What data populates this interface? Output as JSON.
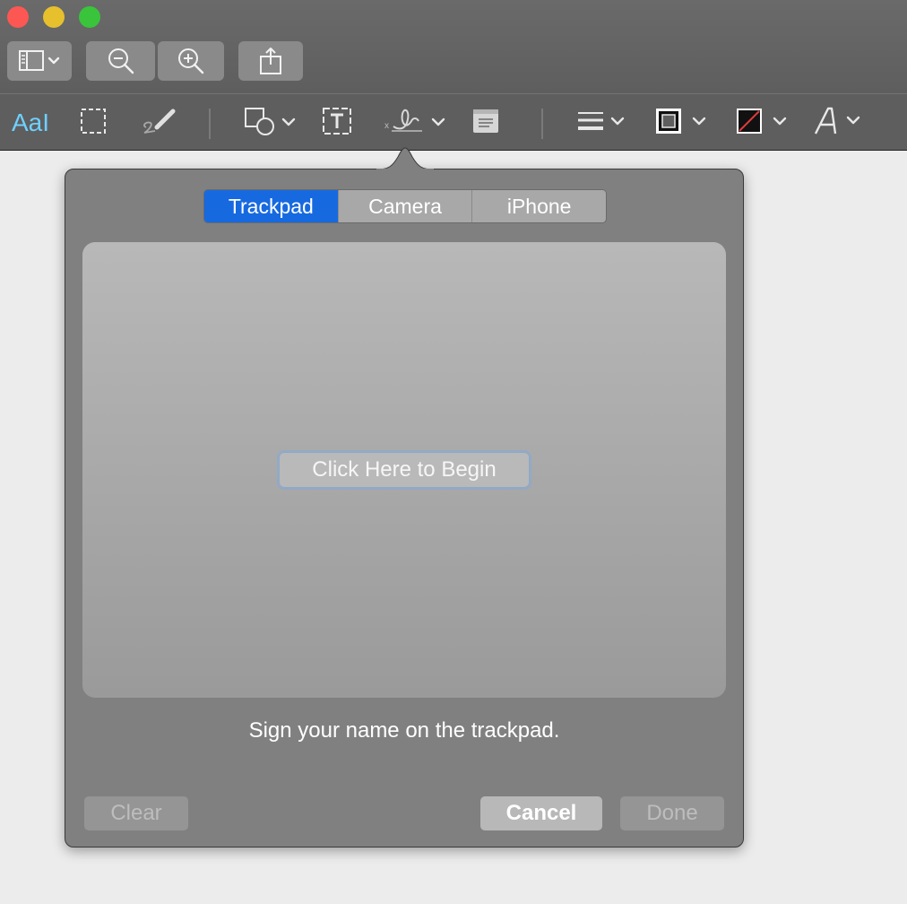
{
  "toolbar": {
    "sidebar_icon": "sidebar-icon",
    "zoom_out_icon": "zoom-out-icon",
    "zoom_in_icon": "zoom-in-icon",
    "share_icon": "share-icon"
  },
  "markup_toolbar": {
    "text_selection_label": "AaI",
    "tools": [
      "text-selection",
      "rectangular-selection",
      "sketch",
      "shapes",
      "text-box",
      "sign",
      "note",
      "line-style",
      "border-color",
      "fill-color",
      "text-style"
    ]
  },
  "signature_popover": {
    "tabs": [
      {
        "label": "Trackpad",
        "active": true
      },
      {
        "label": "Camera",
        "active": false
      },
      {
        "label": "iPhone",
        "active": false
      }
    ],
    "begin_label": "Click Here to Begin",
    "instruction": "Sign your name on the trackpad.",
    "clear_label": "Clear",
    "cancel_label": "Cancel",
    "done_label": "Done"
  },
  "colors": {
    "accent": "#1769e0",
    "toolbar_bg": "#5e5e5e",
    "popover_bg": "#808080",
    "traffic_red": "#fc5753",
    "traffic_yellow": "#e6c02d",
    "traffic_green": "#39c43c"
  }
}
